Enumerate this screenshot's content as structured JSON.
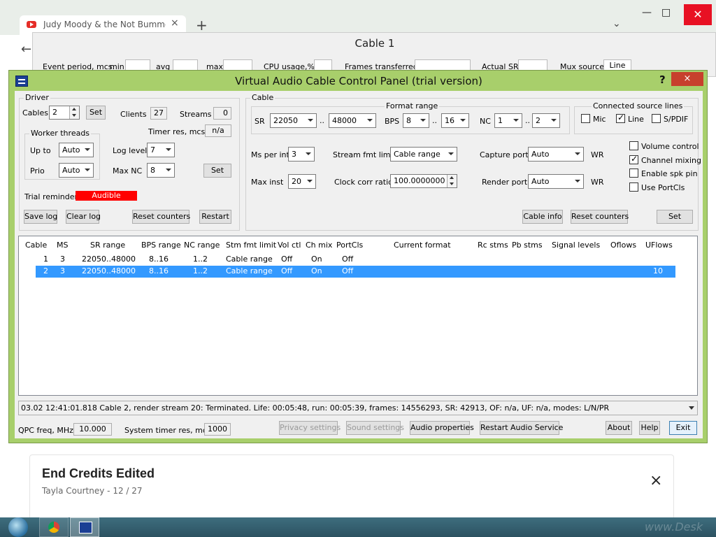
{
  "browser": {
    "tab_title": "Judy Moody & the Not Bummer",
    "new_tab_glyph": "+",
    "close_glyph": "×"
  },
  "cable_window": {
    "title": "Cable 1",
    "event_period": "Event period, mcs:",
    "min": "min",
    "avg": "avg",
    "max": "max",
    "cpu_usage": "CPU usage,%",
    "frames_transferred": "Frames transferred",
    "actual_sr": "Actual SR",
    "mux_source": "Mux source",
    "mux_value": "Line"
  },
  "dialog": {
    "title": "Virtual Audio Cable Control Panel (trial version)",
    "help": "?",
    "close": "×"
  },
  "driver": {
    "group_label": "Driver",
    "cables_label": "Cables",
    "cables_value": "2",
    "set_button": "Set",
    "clients_label": "Clients",
    "clients_value": "27",
    "streams_label": "Streams",
    "streams_value": "0",
    "worker_threads": "Worker threads",
    "timer_res_label": "Timer res, mcs",
    "timer_res_value": "n/a",
    "up_to_label": "Up to",
    "up_to_value": "Auto",
    "log_level_label": "Log level",
    "log_level_value": "7",
    "prio_label": "Prio",
    "prio_value": "Auto",
    "max_nc_label": "Max NC",
    "max_nc_value": "8",
    "set2_button": "Set",
    "trial_reminder_label": "Trial reminder",
    "trial_reminder_value": "Audible",
    "save_log": "Save log",
    "clear_log": "Clear log",
    "reset_counters": "Reset counters",
    "restart": "Restart"
  },
  "cable": {
    "group_label": "Cable",
    "format_range": "Format range",
    "sr_label": "SR",
    "sr_min": "22050",
    "range_sep": "..",
    "sr_max": "48000",
    "bps_label": "BPS",
    "bps_min": "8",
    "bps_max": "16",
    "nc_label": "NC",
    "nc_min": "1",
    "nc_max": "2",
    "connected_label": "Connected source lines",
    "mic": "Mic",
    "line": "Line",
    "spdif": "S/PDIF",
    "ms_per_int_label": "Ms per int",
    "ms_per_int_value": "3",
    "stream_fmt_label": "Stream fmt limit",
    "stream_fmt_value": "Cable range",
    "capture_port_label": "Capture port",
    "capture_port_value": "Auto",
    "wr1": "WR",
    "volume_control": "Volume control",
    "channel_mixing": "Channel mixing",
    "enable_spk_pin": "Enable spk pin",
    "use_portcls": "Use PortCls",
    "max_inst_label": "Max inst",
    "max_inst_value": "20",
    "clock_corr_label": "Clock corr ratio",
    "clock_corr_value": "100.0000000",
    "render_port_label": "Render port",
    "render_port_value": "Auto",
    "wr2": "WR",
    "cable_info": "Cable info",
    "reset_counters": "Reset counters",
    "set_button": "Set"
  },
  "table": {
    "headers": [
      "Cable",
      "MS",
      "SR range",
      "BPS range",
      "NC range",
      "Stm fmt limit",
      "Vol ctl",
      "Ch mix",
      "PortCls",
      "Current format",
      "Rc stms",
      "Pb stms",
      "Signal levels",
      "Oflows",
      "UFlows"
    ],
    "rows": [
      {
        "cable": "1",
        "ms": "3",
        "sr": "22050..48000",
        "bps": "8..16",
        "nc": "1..2",
        "stm": "Cable range",
        "vol": "Off",
        "chmix": "On",
        "portcls": "Off",
        "uflows": ""
      },
      {
        "cable": "2",
        "ms": "3",
        "sr": "22050..48000",
        "bps": "8..16",
        "nc": "1..2",
        "stm": "Cable range",
        "vol": "Off",
        "chmix": "On",
        "portcls": "Off",
        "uflows": "10"
      }
    ]
  },
  "log": {
    "text": "03.02   12:41:01.818   Cable 2, render stream 20: Terminated. Life: 00:05:48, run: 00:05:39, frames: 14556293, SR: 42913, OF: n/a, UF: n/a, modes: L/N/PR"
  },
  "footer": {
    "qpc_label": "QPC freq, MHz",
    "qpc_value": "10.000",
    "sys_timer_label": "System timer res, mcs",
    "sys_timer_value": "1000",
    "privacy_settings": "Privacy settings",
    "sound_settings": "Sound settings",
    "audio_properties": "Audio properties",
    "restart_audio": "Restart Audio Service",
    "about": "About",
    "help": "Help",
    "exit": "Exit"
  },
  "card": {
    "title": "End Credits Edited",
    "subtitle": "Tayla Courtney - 12 / 27",
    "close": "×"
  },
  "watermark": "www.Desk",
  "colors": {
    "dialog_frame": "#a8cf6b",
    "close_red": "#c7402d",
    "selection": "#3399ff",
    "trial_red": "#ff0000"
  }
}
